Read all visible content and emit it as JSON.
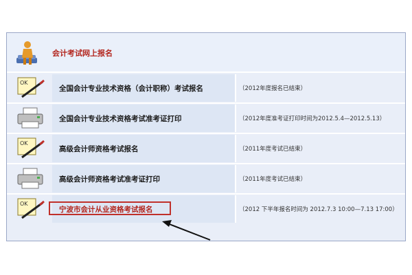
{
  "header": {
    "title": "会计考试网上报名"
  },
  "rows": [
    {
      "label": "全国会计专业技术资格（会计职称）考试报名",
      "status": "（2012年度报名已结束）",
      "icon": "pen-ok-icon"
    },
    {
      "label": "全国会计专业技术资格考试准考证打印",
      "status": "（2012年度准考证打印时间为2012.5.4—2012.5.13）",
      "icon": "printer-icon"
    },
    {
      "label": "高级会计师资格考试报名",
      "status": "（2011年度考试已结束）",
      "icon": "pen-ok-icon"
    },
    {
      "label": "高级会计师资格考试准考证打印",
      "status": "（2011年度考试已结束）",
      "icon": "printer-icon"
    },
    {
      "label": "宁波市会计从业资格考试报名",
      "status": "（2012 下半年报名时间为 2012.7.3 10:00—7.13 17:00）",
      "icon": "pen-ok-icon"
    }
  ],
  "colors": {
    "accent": "#b3261e",
    "panel": "#e9eef8",
    "row": "#dde6f4",
    "border": "#9aa7c7"
  }
}
